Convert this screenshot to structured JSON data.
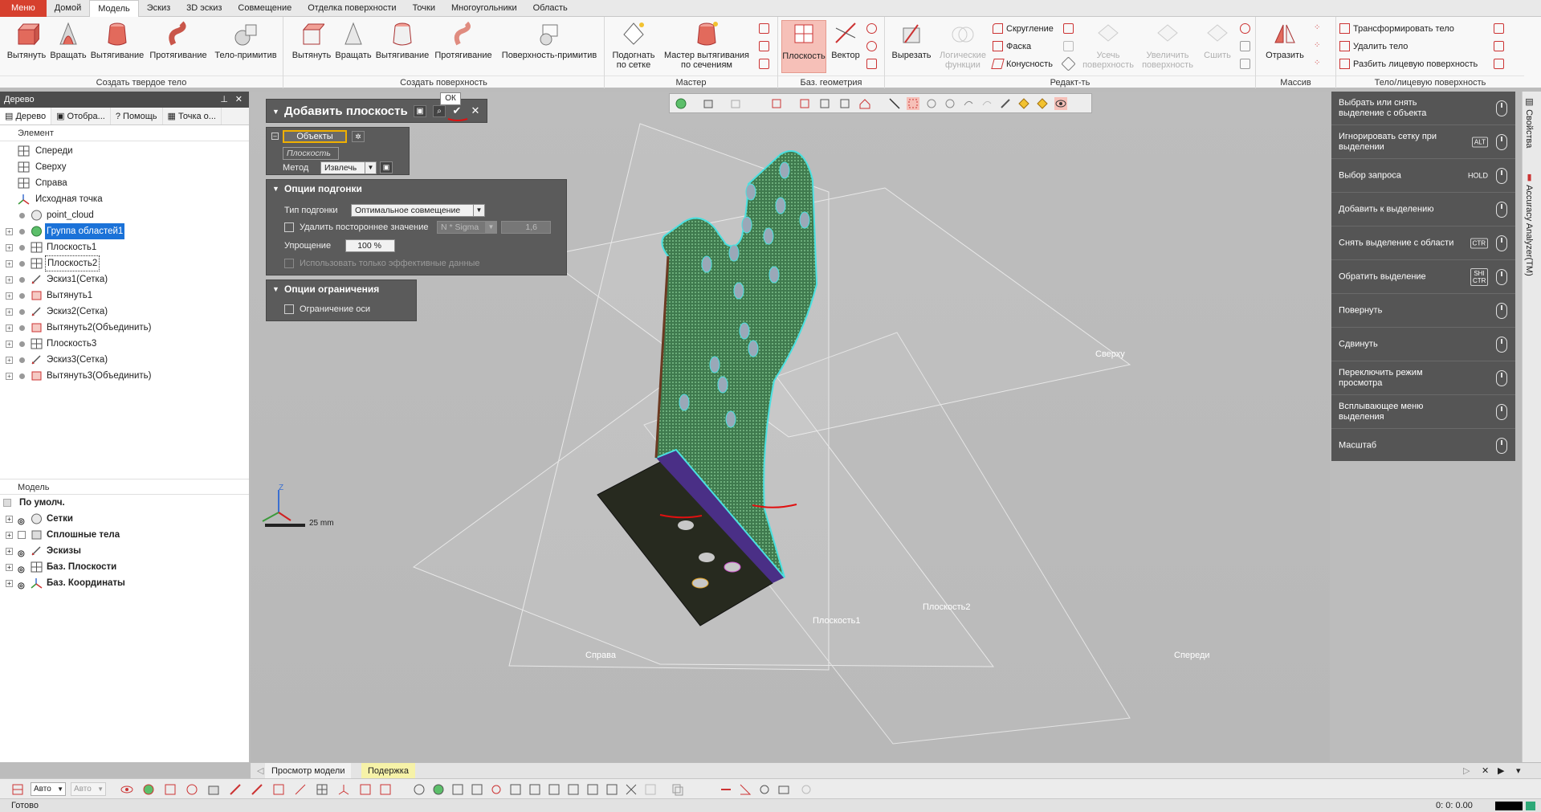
{
  "menubar": {
    "tabs": [
      "Меню",
      "Домой",
      "Модель",
      "Эскиз",
      "3D эскиз",
      "Совмещение",
      "Отделка поверхности",
      "Точки",
      "Многоугольники",
      "Область"
    ],
    "active": "Модель"
  },
  "ribbon": {
    "solid": {
      "title": "Создать твердое тело",
      "buttons": [
        "Вытянуть",
        "Вращать",
        "Вытягивание",
        "Протягивание",
        "Тело-примитив"
      ]
    },
    "surface": {
      "title": "Создать поверхность",
      "buttons": [
        "Вытянуть",
        "Вращать",
        "Вытягивание",
        "Протягивание",
        "Поверхность-примитив"
      ]
    },
    "master": {
      "title": "Мастер",
      "buttons": [
        "Подогнать по сетке",
        "Мастер вытягивания по сечениям"
      ]
    },
    "refgeom": {
      "title": "Баз. геометрия",
      "buttons": [
        "Плоскость",
        "Вектор"
      ]
    },
    "edit": {
      "title": "Редакт-ть",
      "buttons": [
        "Вырезать",
        "Логические функции",
        "Усечь поверхность",
        "Увеличить поверхность",
        "Сшить"
      ],
      "small": [
        "Скругление",
        "Фаска",
        "Конусность"
      ]
    },
    "array": {
      "title": "Массив",
      "buttons": [
        "Отразить"
      ]
    },
    "body": {
      "title": "Тело/лицевую поверхность",
      "small": [
        "Трансформировать тело",
        "Удалить тело",
        "Разбить лицевую поверхность"
      ]
    }
  },
  "leftpanel": {
    "title": "Дерево",
    "tabs": [
      "Дерево",
      "Отобра...",
      "Помощь",
      "Точка о..."
    ],
    "element_header": "Элемент",
    "tree": [
      "Спереди",
      "Сверху",
      "Справа",
      "Исходная точка",
      "point_cloud",
      "Группа областей1",
      "Плоскость1",
      "Плоскость2",
      "Эскиз1(Сетка)",
      "Вытянуть1",
      "Эскиз2(Сетка)",
      "Вытянуть2(Объединить)",
      "Плоскость3",
      "Эскиз3(Сетка)",
      "Вытянуть3(Объединить)"
    ],
    "model_header": "Модель",
    "model": [
      "По умолч.",
      "Сетки",
      "Сплошные тела",
      "Эскизы",
      "Баз. Плоскости",
      "Баз. Координаты"
    ]
  },
  "dialog": {
    "title": "Добавить плоскость",
    "ok_tooltip": "ОК",
    "objects_label": "Объекты",
    "objects_value": "Плоскость",
    "method_label": "Метод",
    "method_value": "Извлечь",
    "fit_options": {
      "title": "Опции подгонки",
      "fit_type_label": "Тип подгонки",
      "fit_type_value": "Оптимальное совмещение",
      "remove_outliers_label": "Удалить постороннее значение",
      "sigma_value": "N * Sigma",
      "sigma_number": "1,6",
      "simplify_label": "Упрощение",
      "simplify_value": "100 %",
      "effective_label": "Использовать только эффективные данные"
    },
    "constraint_options": {
      "title": "Опции ограничения",
      "axis_label": "Ограничение оси"
    }
  },
  "viewport": {
    "labels": [
      "Сверху",
      "Справа",
      "Спереди",
      "Плоскость1",
      "Плоскость2"
    ],
    "scale": "25 mm"
  },
  "quickmenu": [
    {
      "text": "Выбрать или снять выделение с объекта",
      "key": ""
    },
    {
      "text": "Игнорировать сетку при выделении",
      "key": "ALT"
    },
    {
      "text": "Выбор запроса",
      "key": "HOLD"
    },
    {
      "text": "Добавить к выделению",
      "key": ""
    },
    {
      "text": "Снять выделение с области",
      "key": "CTR"
    },
    {
      "text": "Обратить выделение",
      "key": "SHI CTR"
    },
    {
      "text": "Повернуть",
      "key": ""
    },
    {
      "text": "Сдвинуть",
      "key": ""
    },
    {
      "text": "Переключить режим просмотра",
      "key": ""
    },
    {
      "text": "Всплывающее меню выделения",
      "key": ""
    },
    {
      "text": "Масштаб",
      "key": ""
    }
  ],
  "sidetabs": [
    "Свойства",
    "Accuracy Analyzer(TM)"
  ],
  "bottomtabs": [
    "Просмотр модели",
    "Подержка"
  ],
  "bottomtb": {
    "combo1": "Авто",
    "combo2": "Авто"
  },
  "status": {
    "text": "Готово",
    "time": "0: 0: 0.00"
  },
  "colors": {
    "accent": "#d6402e",
    "selection": "#1b72d8",
    "mesh": "#2ea877",
    "dialog_bg": "#5b5b5b"
  }
}
